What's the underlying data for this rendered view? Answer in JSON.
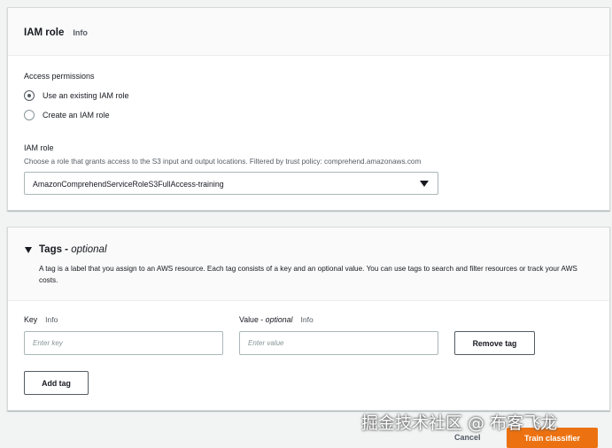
{
  "iam": {
    "title": "IAM role",
    "info": "Info",
    "access_permissions_label": "Access permissions",
    "options": [
      {
        "label": "Use an existing IAM role",
        "checked": true
      },
      {
        "label": "Create an IAM role",
        "checked": false
      }
    ],
    "role_label": "IAM role",
    "role_description": "Choose a role that grants access to the S3 input and output locations. Filtered by trust policy: comprehend.amazonaws.com",
    "role_selected": "AmazonComprehendServiceRoleS3FullAccess-training"
  },
  "tags": {
    "title": "Tags - ",
    "title_optional": "optional",
    "description": "A tag is a label that you assign to an AWS resource. Each tag consists of a key and an optional value. You can use tags to search and filter resources or track your AWS costs.",
    "key_label": "Key",
    "key_info": "Info",
    "value_label": "Value - ",
    "value_optional": "optional",
    "value_info": "Info",
    "key_placeholder": "Enter key",
    "value_placeholder": "Enter value",
    "remove_tag_label": "Remove tag",
    "add_tag_label": "Add tag"
  },
  "footer": {
    "cancel_label": "Cancel",
    "train_label": "Train classifier"
  },
  "watermark": "掘金技术社区 @ 布客飞龙",
  "colors": {
    "primary_button": "#ec7211",
    "page_background": "#f2f3f3"
  }
}
